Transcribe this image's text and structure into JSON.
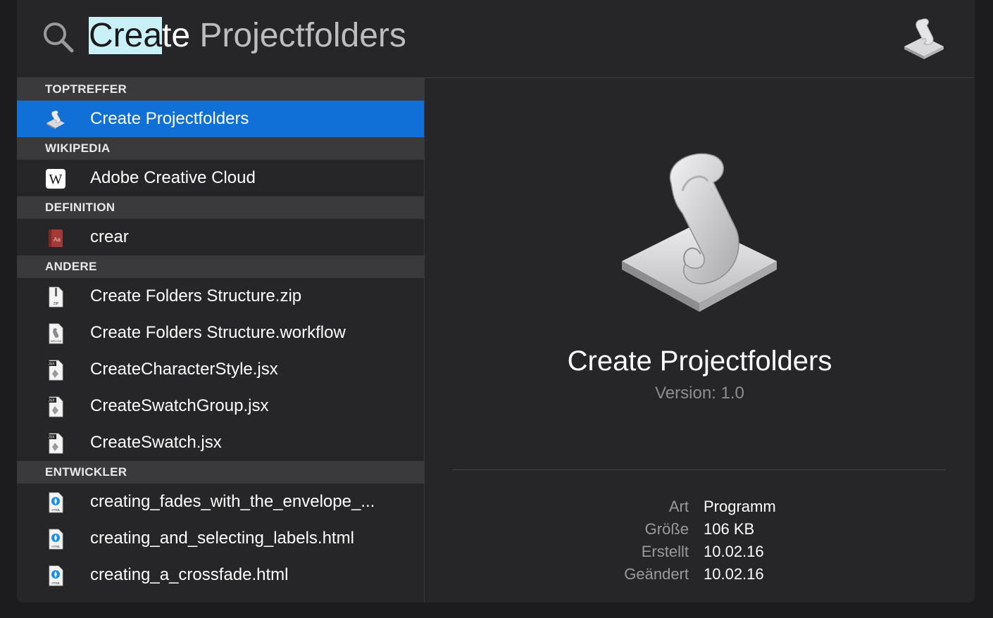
{
  "search": {
    "query_selected": "Crea",
    "query_typed": "te",
    "query_completion": " Projectfolders"
  },
  "results": {
    "sections": [
      {
        "header": "TOPTREFFER",
        "items": [
          {
            "label": "Create Projectfolders",
            "icon": "automator-app-icon",
            "selected": true
          }
        ]
      },
      {
        "header": "WIKIPEDIA",
        "items": [
          {
            "label": "Adobe Creative Cloud",
            "icon": "wikipedia-icon"
          }
        ]
      },
      {
        "header": "DEFINITION",
        "items": [
          {
            "label": "crear",
            "icon": "dictionary-icon"
          }
        ]
      },
      {
        "header": "ANDERE",
        "items": [
          {
            "label": "Create Folders Structure.zip",
            "icon": "zip-file-icon"
          },
          {
            "label": "Create Folders Structure.workflow",
            "icon": "workflow-file-icon"
          },
          {
            "label": "CreateCharacterStyle.jsx",
            "icon": "jsx-file-icon"
          },
          {
            "label": "CreateSwatchGroup.jsx",
            "icon": "jsx-file-icon"
          },
          {
            "label": "CreateSwatch.jsx",
            "icon": "jsx-file-icon"
          }
        ]
      },
      {
        "header": "ENTWICKLER",
        "items": [
          {
            "label": "creating_fades_with_the_envelope_...",
            "icon": "html-file-icon"
          },
          {
            "label": "creating_and_selecting_labels.html",
            "icon": "html-file-icon"
          },
          {
            "label": "creating_a_crossfade.html",
            "icon": "html-file-icon"
          }
        ]
      }
    ]
  },
  "preview": {
    "title": "Create Projectfolders",
    "version": "Version: 1.0",
    "meta": [
      {
        "key": "Art",
        "value": "Programm"
      },
      {
        "key": "Größe",
        "value": "106 KB"
      },
      {
        "key": "Erstellt",
        "value": "10.02.16"
      },
      {
        "key": "Geändert",
        "value": "10.02.16"
      }
    ]
  },
  "colors": {
    "selection": "#1170d6",
    "query_highlight": "#c8f0f6",
    "background": "#262628"
  }
}
